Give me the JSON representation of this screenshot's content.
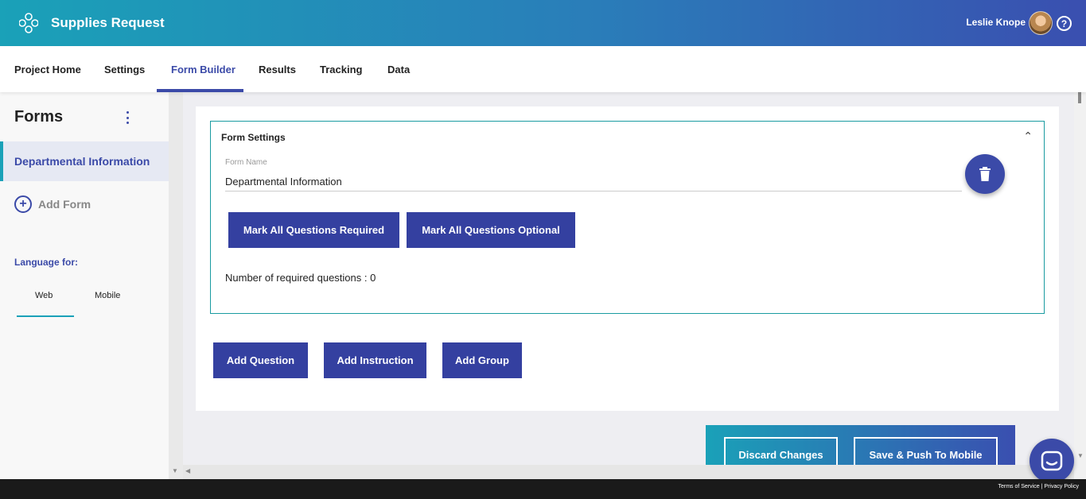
{
  "app": {
    "title": "Supplies Request"
  },
  "user": {
    "name": "Leslie Knope"
  },
  "nav": {
    "tabs": [
      {
        "label": "Project Home"
      },
      {
        "label": "Settings"
      },
      {
        "label": "Form Builder",
        "active": true
      },
      {
        "label": "Results"
      },
      {
        "label": "Tracking"
      },
      {
        "label": "Data"
      }
    ]
  },
  "sidebar": {
    "title": "Forms",
    "forms": [
      {
        "label": "Departmental Information",
        "selected": true
      }
    ],
    "add_form_label": "Add Form",
    "language_label": "Language for:",
    "language_tabs": [
      {
        "label": "Web",
        "active": true
      },
      {
        "label": "Mobile"
      }
    ]
  },
  "form_settings": {
    "title": "Form Settings",
    "form_name_label": "Form Name",
    "form_name_value": "Departmental Information",
    "mark_required_label": "Mark All Questions Required",
    "mark_optional_label": "Mark All Questions Optional",
    "required_count_text": "Number of required questions : 0"
  },
  "actions": {
    "add_question": "Add Question",
    "add_instruction": "Add Instruction",
    "add_group": "Add Group",
    "discard": "Discard Changes",
    "save_push": "Save & Push To Mobile"
  },
  "footer": {
    "terms": "Terms of Service",
    "privacy": "Privacy Policy"
  },
  "colors": {
    "primary": "#3b4aa8",
    "teal": "#1aa1b8"
  }
}
